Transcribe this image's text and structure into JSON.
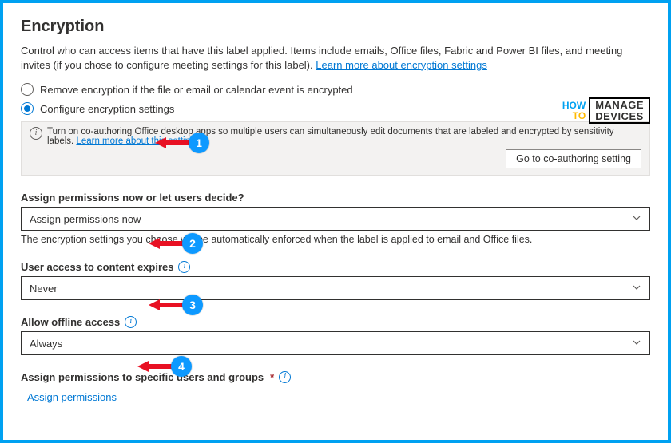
{
  "title": "Encryption",
  "intro_text": "Control who can access items that have this label applied. Items include emails, Office files, Fabric and Power BI files, and meeting invites (if you chose to configure meeting settings for this label). ",
  "intro_link": "Learn more about encryption settings",
  "radios": {
    "remove": "Remove encryption if the file or email or calendar event is encrypted",
    "configure": "Configure encryption settings"
  },
  "infobar": {
    "text": "Turn on co-authoring Office desktop apps so multiple users can simultaneously edit documents that are labeled and encrypted by sensitivity labels.  ",
    "link": "Learn more about this setting",
    "button": "Go to co-authoring setting"
  },
  "assign_perms": {
    "label": "Assign permissions now or let users decide?",
    "value": "Assign permissions now",
    "helper": "The encryption settings you choose will be automatically enforced when the label is applied to email and Office files."
  },
  "expires": {
    "label": "User access to content expires",
    "value": "Never"
  },
  "offline": {
    "label": "Allow offline access",
    "value": "Always"
  },
  "specific": {
    "label": "Assign permissions to specific users and groups",
    "link": "Assign permissions"
  },
  "logo": {
    "how": "HOW",
    "to": "TO",
    "line1": "MANAGE",
    "line2": "DEVICES"
  },
  "badges": {
    "b1": "1",
    "b2": "2",
    "b3": "3",
    "b4": "4"
  }
}
